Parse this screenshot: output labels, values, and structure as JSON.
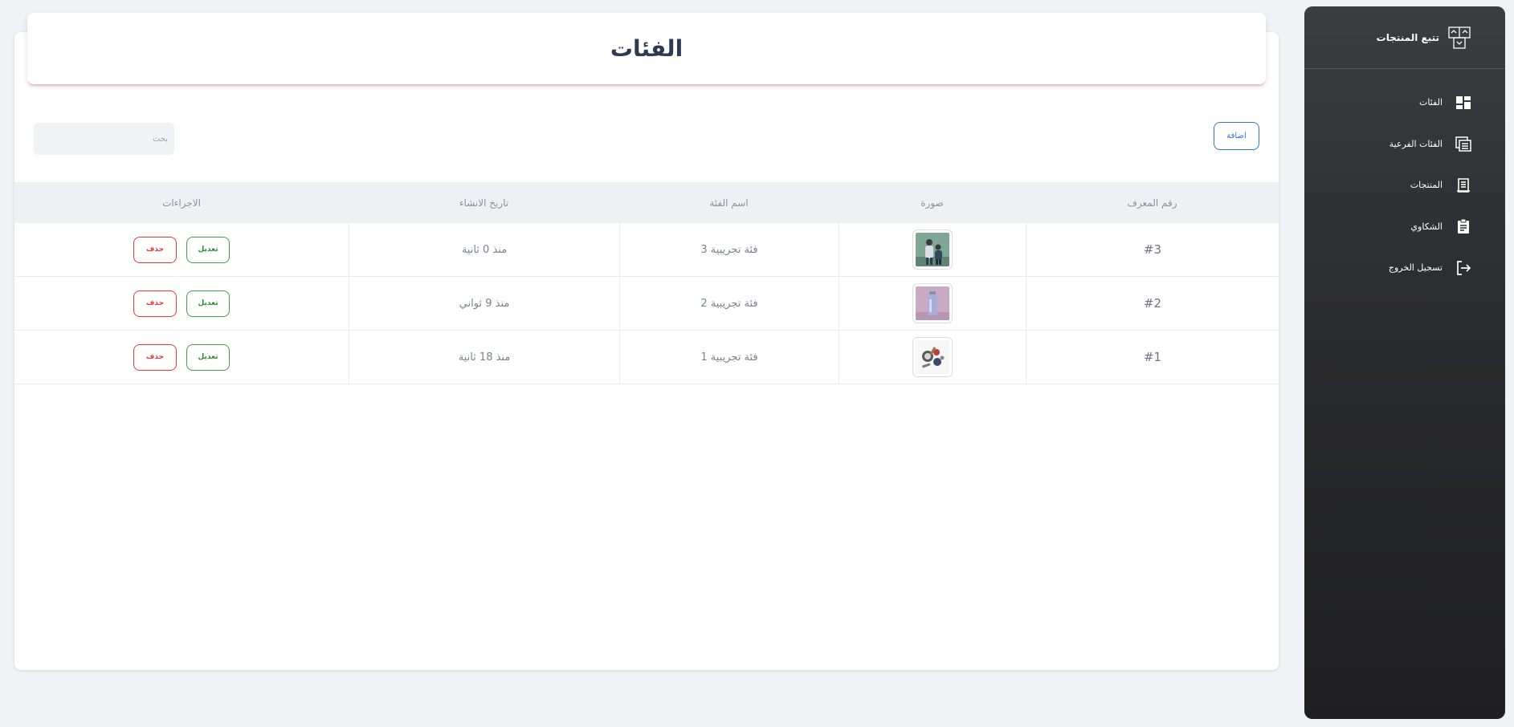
{
  "app": {
    "brand_label": "تتبع المنتجات",
    "brand_icon": "package-tracking-icon"
  },
  "sidebar": {
    "items": [
      {
        "label": "الفئات",
        "icon": "dashboard-grid-icon"
      },
      {
        "label": "الفئات الفرعية",
        "icon": "subcategories-icon"
      },
      {
        "label": "المنتجات",
        "icon": "receipt-icon"
      },
      {
        "label": "الشكاوي",
        "icon": "clipboard-icon"
      },
      {
        "label": "تسجيل الخروج",
        "icon": "logout-icon"
      }
    ]
  },
  "page": {
    "title": "الفئات"
  },
  "toolbar": {
    "add_label": "اضافة",
    "search_placeholder": "بحث"
  },
  "table": {
    "headers": [
      "رقم المعرف",
      "صورة",
      "اسم الفئة",
      "تاريخ الانشاء",
      "الاجراءات"
    ],
    "rows": [
      {
        "id": "#3",
        "name": "فئة تجريبية 3",
        "created": "منذ 0 ثانية",
        "edit": "تعديل",
        "delete": "حذف"
      },
      {
        "id": "#2",
        "name": "فئة تجريبية 2",
        "created": "منذ 9 ثواني",
        "edit": "تعديل",
        "delete": "حذف"
      },
      {
        "id": "#1",
        "name": "فئة تجريبية 1",
        "created": "منذ 18 ثانية",
        "edit": "تعديل",
        "delete": "حذف"
      }
    ]
  },
  "colors": {
    "accent": "#2f73d9",
    "danger": "#e53935",
    "success": "#43a047",
    "sidebar": "#2c2d30"
  }
}
